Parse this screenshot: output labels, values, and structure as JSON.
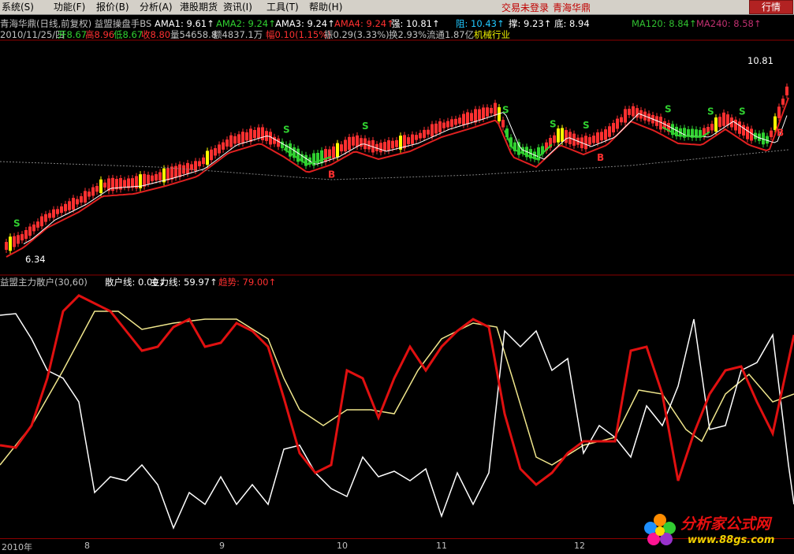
{
  "menubar": {
    "items": [
      {
        "label": "系统(S)",
        "name": "menu-system"
      },
      {
        "label": "功能(F)",
        "name": "menu-function"
      },
      {
        "label": "报价(B)",
        "name": "menu-quote"
      },
      {
        "label": "分析(A)",
        "name": "menu-analysis"
      },
      {
        "label": "港股期货",
        "name": "menu-hk-futures"
      },
      {
        "label": "资讯(I)",
        "name": "menu-info"
      },
      {
        "label": "工具(T)",
        "name": "menu-tools"
      },
      {
        "label": "帮助(H)",
        "name": "menu-help"
      }
    ],
    "login_status": "交易未登录",
    "stock_link": "青海华鼎",
    "quote_button": "行情"
  },
  "header": {
    "line1": [
      {
        "text": "青海华鼎(日线,前复权) 益盟操盘手BS",
        "color": "#c0c0c0"
      },
      {
        "text": "AMA1: 9.61↑",
        "color": "#ffffff"
      },
      {
        "text": "AMA2: 9.24↑",
        "color": "#30d030"
      },
      {
        "text": "AMA3: 9.24↑",
        "color": "#ffffff"
      },
      {
        "text": "AMA4: 9.24↑",
        "color": "#ff3030"
      },
      {
        "text": "强: 10.81↑",
        "color": "#ffffff"
      },
      {
        "text": "阻: 10.43↑",
        "color": "#20c8ff"
      },
      {
        "text": "撑: 9.23↑",
        "color": "#ffffff"
      },
      {
        "text": "底: 8.94",
        "color": "#ffffff"
      },
      {
        "text": "MA120: 8.84↑",
        "color": "#30c030"
      },
      {
        "text": "MA240: 8.58↑",
        "color": "#c03070"
      }
    ],
    "line2": [
      {
        "text": "2010/11/25/四",
        "color": "#c0c0c0"
      },
      {
        "text": "开8.67",
        "color": "#30d030"
      },
      {
        "text": "高8.96",
        "color": "#ff3030"
      },
      {
        "text": "低8.67",
        "color": "#30d030"
      },
      {
        "text": "收8.80",
        "color": "#ff3030"
      },
      {
        "text": "量54658.8",
        "color": "#c0c0c0"
      },
      {
        "text": "额4837.1万",
        "color": "#c0c0c0"
      },
      {
        "text": "幅0.10(1.15%)",
        "color": "#ff3030"
      },
      {
        "text": "振0.29(3.33%)",
        "color": "#c0c0c0"
      },
      {
        "text": "换2.93%",
        "color": "#c0c0c0"
      },
      {
        "text": "流通1.87亿",
        "color": "#c0c0c0"
      },
      {
        "text": "机械行业",
        "color": "#f0f000"
      }
    ]
  },
  "price_panel": {
    "high_marker": "10.81",
    "low_marker": "6.34",
    "signals": [
      {
        "text": "S",
        "type": "sell"
      },
      {
        "text": "S",
        "type": "sell"
      },
      {
        "text": "B",
        "type": "buy"
      },
      {
        "text": "S",
        "type": "sell"
      },
      {
        "text": "S",
        "type": "sell"
      },
      {
        "text": "S",
        "type": "sell"
      },
      {
        "text": "S",
        "type": "sell"
      },
      {
        "text": "B",
        "type": "buy"
      },
      {
        "text": "S",
        "type": "sell"
      },
      {
        "text": "S",
        "type": "sell"
      },
      {
        "text": "S",
        "type": "sell"
      },
      {
        "text": "B",
        "type": "buy"
      }
    ]
  },
  "indicator_panel": {
    "line": [
      {
        "text": "益盟主力散户(30,60)",
        "color": "#c0c0c0"
      },
      {
        "text": "散户线: 0.00↓",
        "color": "#ffffff"
      },
      {
        "text": "主力线: 59.97↑",
        "color": "#ffffff"
      },
      {
        "text": "趋势: 79.00↑",
        "color": "#ff3030"
      }
    ]
  },
  "time_axis": {
    "labels": [
      "2010年",
      "8",
      "9",
      "10",
      "11",
      "12"
    ]
  },
  "watermark": {
    "title": "分析家公式网",
    "url": "www.88gs.com"
  },
  "colors": {
    "up": "#ff3030",
    "down": "#30d030",
    "neutral": "#ffff00",
    "background": "#000000",
    "grid": "#8b0000"
  }
}
